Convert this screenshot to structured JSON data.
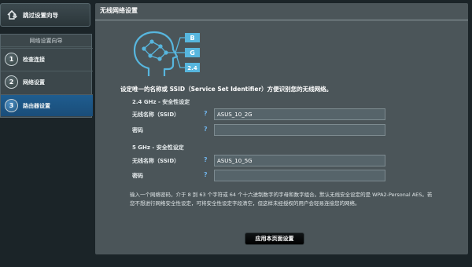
{
  "sidebar": {
    "skip_label": "跳过设置向导",
    "skip_icon": "wizard-exit-icon",
    "wizard_title": "网络设置向导",
    "steps": [
      {
        "num": "1",
        "label": "检查连接"
      },
      {
        "num": "2",
        "label": "网络设置"
      },
      {
        "num": "3",
        "label": "路由器设置"
      }
    ],
    "active_step": 3
  },
  "main": {
    "title": "无线网络设置",
    "illustration": {
      "icon": "head-network-icon",
      "labels": [
        "B",
        "G",
        "2.4"
      ]
    },
    "description": "设定唯一的名称或 SSID（Service Set Identifier）方便识别您的无线网络。",
    "band24": {
      "title": "2.4 GHz - 安全性设定",
      "ssid_label": "无线名称（SSID）",
      "ssid_value": "ASUS_10_2G",
      "key_label": "密码",
      "key_value": ""
    },
    "band5": {
      "title": "5 GHz - 安全性设定",
      "ssid_label": "无线名称（SSID）",
      "ssid_value": "ASUS_10_5G",
      "key_label": "密码",
      "key_value": ""
    },
    "note": "输入一个网络密码，介于 8 到 63 个字符或 64 个十六进制数字的字母和数字组合。默认无线安全设定的是 WPA2-Personal AES。若您不想进行网络安全性设定，可将安全性设定字段清空，但这样未经授权的用户会轻易连接您的网络。",
    "help_glyph": "?",
    "apply_label": "应用本页面设置"
  },
  "colors": {
    "background": "#1b2428",
    "panel": "#4b5559",
    "active_step": "#1f5d8f",
    "help_icon": "#6fb2e8",
    "illustration": "#57b6de"
  }
}
